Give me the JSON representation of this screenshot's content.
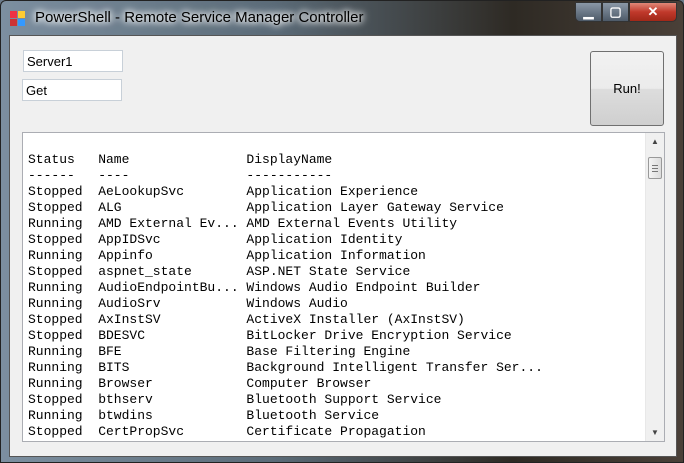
{
  "window": {
    "title": "PowerShell - Remote Service Manager Controller"
  },
  "inputs": {
    "server": "Server1",
    "action": "Get"
  },
  "run_label": "Run!",
  "output": {
    "headers": [
      "Status",
      "Name",
      "DisplayName"
    ],
    "separators": [
      "------",
      "----",
      "-----------"
    ],
    "rows": [
      [
        "Stopped",
        "AeLookupSvc",
        "Application Experience"
      ],
      [
        "Stopped",
        "ALG",
        "Application Layer Gateway Service"
      ],
      [
        "Running",
        "AMD External Ev...",
        "AMD External Events Utility"
      ],
      [
        "Stopped",
        "AppIDSvc",
        "Application Identity"
      ],
      [
        "Running",
        "Appinfo",
        "Application Information"
      ],
      [
        "Stopped",
        "aspnet_state",
        "ASP.NET State Service"
      ],
      [
        "Running",
        "AudioEndpointBu...",
        "Windows Audio Endpoint Builder"
      ],
      [
        "Running",
        "AudioSrv",
        "Windows Audio"
      ],
      [
        "Stopped",
        "AxInstSV",
        "ActiveX Installer (AxInstSV)"
      ],
      [
        "Stopped",
        "BDESVC",
        "BitLocker Drive Encryption Service"
      ],
      [
        "Running",
        "BFE",
        "Base Filtering Engine"
      ],
      [
        "Running",
        "BITS",
        "Background Intelligent Transfer Ser..."
      ],
      [
        "Running",
        "Browser",
        "Computer Browser"
      ],
      [
        "Stopped",
        "bthserv",
        "Bluetooth Support Service"
      ],
      [
        "Running",
        "btwdins",
        "Bluetooth Service"
      ],
      [
        "Stopped",
        "CertPropSvc",
        "Certificate Propagation"
      ]
    ]
  }
}
